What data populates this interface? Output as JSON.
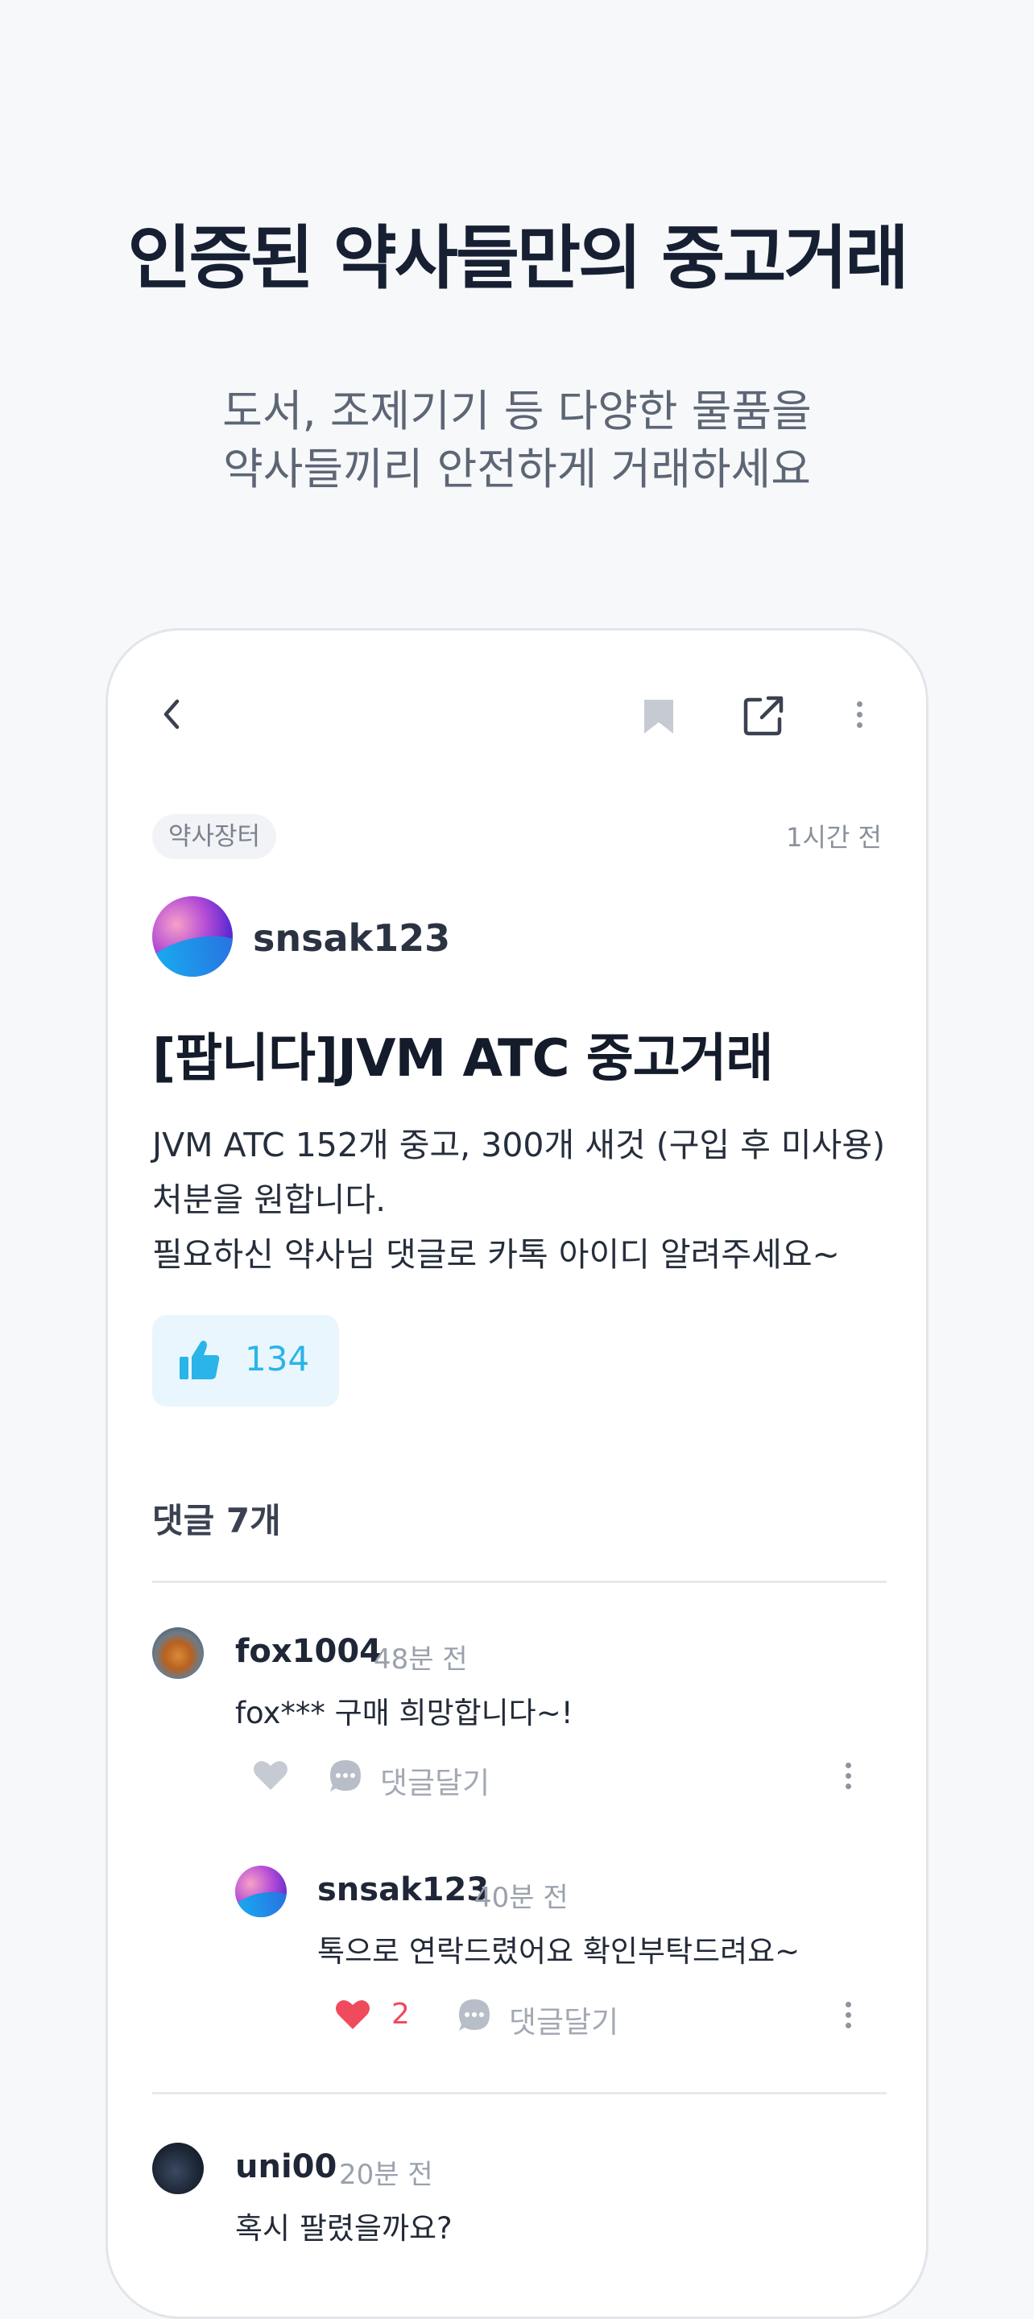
{
  "hero": {
    "title": "인증된 약사들만의 중고거래",
    "subtitle_line1": "도서, 조제기기 등 다양한 물품을",
    "subtitle_line2": "약사들끼리 안전하게 거래하세요"
  },
  "toolbar": {
    "back_icon": "chevron-left-icon",
    "bookmark_icon": "bookmark-icon",
    "share_icon": "share-icon",
    "more_icon": "more-vertical-icon"
  },
  "post": {
    "category": "약사장터",
    "time": "1시간 전",
    "author": "snsak123",
    "title": "[팝니다]JVM ATC 중고거래",
    "body": [
      "JVM ATC 152개 중고, 300개 새것 (구입 후 미사용)",
      "처분을 원합니다.",
      "필요하신 약사님 댓글로 카톡 아이디 알려주세요~"
    ],
    "likes": "134"
  },
  "comments": {
    "header": "댓글 7개",
    "reply_label": "댓글달기",
    "items": [
      {
        "author": "fox1004",
        "time": "48분 전",
        "text": "fox*** 구매 희망합니다~!",
        "likes": ""
      },
      {
        "author": "snsak123",
        "time": "40분 전",
        "text": "톡으로 연락드렸어요 확인부탁드려요~",
        "likes": "2"
      },
      {
        "author": "uni00",
        "time": "20분 전",
        "text": "혹시 팔렸을까요?",
        "likes": ""
      }
    ]
  },
  "colors": {
    "accent": "#2ab4e8",
    "like_active": "#f04a5d",
    "background": "#f7f8fa"
  }
}
